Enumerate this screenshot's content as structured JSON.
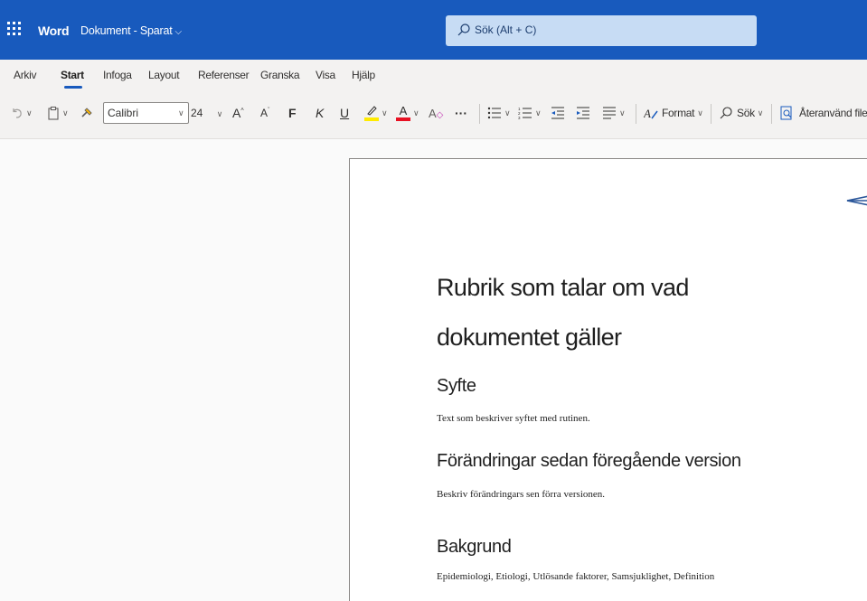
{
  "titlebar": {
    "app_name": "Word",
    "document_name": "Dokument - Sparat",
    "search_placeholder": "Sök (Alt + C)",
    "background": "#185abd"
  },
  "ribbon": {
    "tabs": [
      {
        "label": "Arkiv"
      },
      {
        "label": "Start"
      },
      {
        "label": "Infoga"
      },
      {
        "label": "Layout"
      },
      {
        "label": "Referenser"
      },
      {
        "label": "Granska"
      },
      {
        "label": "Visa"
      },
      {
        "label": "Hjälp"
      }
    ],
    "active_tab": "Start",
    "toolbar": {
      "font_name": "Calibri",
      "font_size": "24",
      "bold_label": "F",
      "italic_label": "K",
      "underline_label": "U",
      "format_label": "Format",
      "find_label": "Sök",
      "reuse_label": "Återanvänd filer",
      "more_label": "···",
      "highlight_color": "#ffeb00",
      "font_color": "#e81123"
    }
  },
  "document": {
    "title": "Rubrik som talar om vad dokumentet gäller",
    "sections": [
      {
        "heading": "Syfte",
        "body": "Text som beskriver syftet med rutinen."
      },
      {
        "heading": "Förändringar sedan föregående version",
        "body": "Beskriv förändringars sen förra versionen."
      },
      {
        "heading": "Bakgrund",
        "body": "Epidemiologi, Etiologi, Utlösande faktorer, Samsjuklighet, Definition"
      }
    ]
  }
}
